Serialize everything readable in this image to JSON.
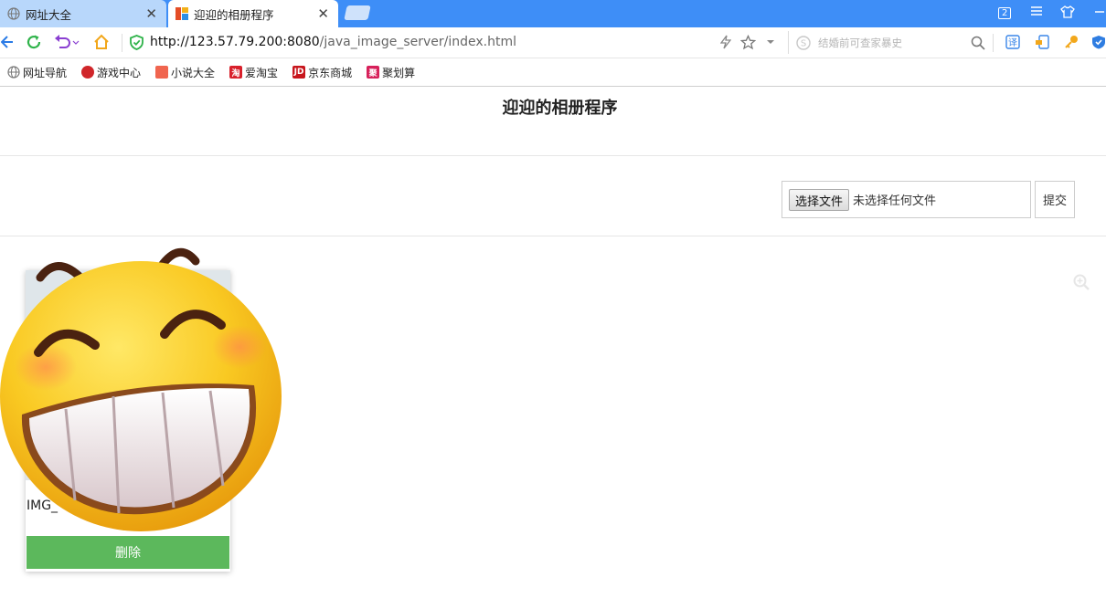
{
  "browser": {
    "tabs": [
      {
        "label": "网址大全",
        "active": false
      },
      {
        "label": "迎迎的相册程序",
        "active": true
      }
    ],
    "tab_count_badge": "2",
    "url": {
      "host": "http://123.57.79.200:8080",
      "path": "/java_image_server/index.html"
    },
    "search_placeholder": "结婚前可查家暴史",
    "bookmarks": [
      {
        "label": "网址导航",
        "icon": "globe-icon",
        "color": "#888888",
        "glyph": ""
      },
      {
        "label": "游戏中心",
        "icon": "game-icon",
        "color": "#d0262a",
        "glyph": ""
      },
      {
        "label": "小说大全",
        "icon": "book-icon",
        "color": "#f0654f",
        "glyph": ""
      },
      {
        "label": "爱淘宝",
        "icon": "taobao-icon",
        "color": "#d8202b",
        "glyph": "淘"
      },
      {
        "label": "京东商城",
        "icon": "jd-icon",
        "color": "#c8161d",
        "glyph": "JD"
      },
      {
        "label": "聚划算",
        "icon": "juhuasuan-icon",
        "color": "#d7205a",
        "glyph": "聚"
      }
    ]
  },
  "page": {
    "title": "迎迎的相册程序",
    "upload": {
      "choose_label": "选择文件",
      "no_file_label": "未选择任何文件",
      "submit_label": "提交"
    },
    "images": [
      {
        "name": "IMG_",
        "delete_label": "删除"
      }
    ]
  },
  "colors": {
    "tab_bar": "#3e8ef7",
    "delete_button": "#5cb85c",
    "emoji_face": "#f7c21c"
  }
}
